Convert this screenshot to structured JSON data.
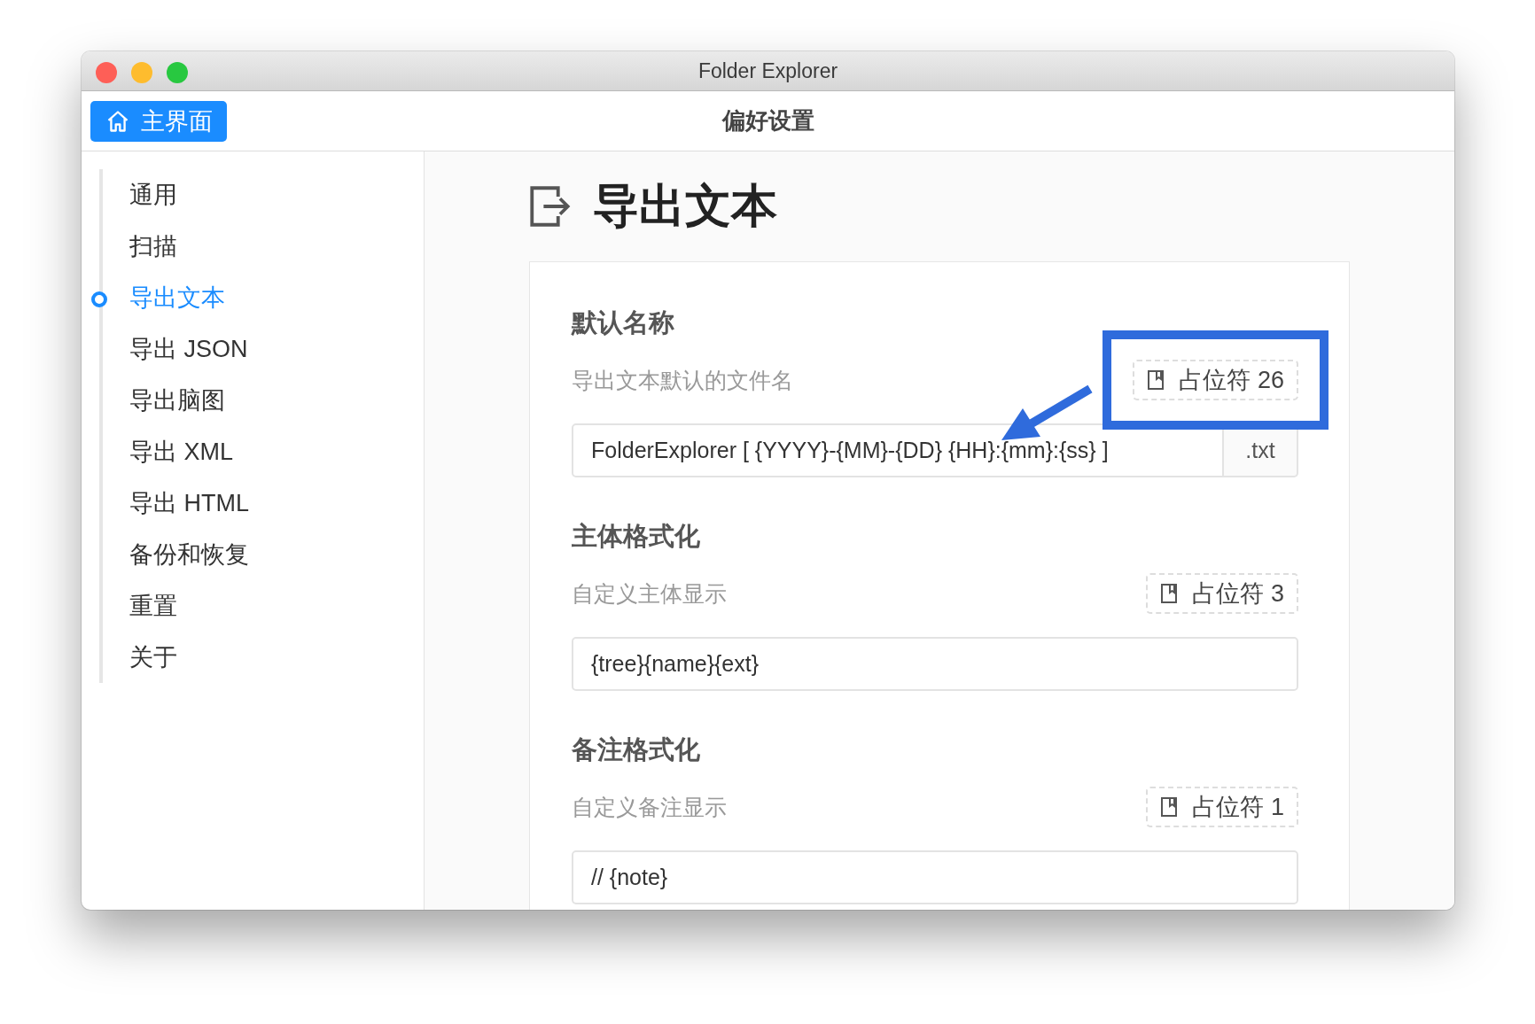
{
  "window": {
    "title": "Folder Explorer"
  },
  "toolbar": {
    "home_button": "主界面",
    "title": "偏好设置"
  },
  "sidebar": {
    "items": [
      {
        "label": "通用",
        "selected": false
      },
      {
        "label": "扫描",
        "selected": false
      },
      {
        "label": "导出文本",
        "selected": true
      },
      {
        "label": "导出 JSON",
        "selected": false
      },
      {
        "label": "导出脑图",
        "selected": false
      },
      {
        "label": "导出 XML",
        "selected": false
      },
      {
        "label": "导出 HTML",
        "selected": false
      },
      {
        "label": "备份和恢复",
        "selected": false
      },
      {
        "label": "重置",
        "selected": false
      },
      {
        "label": "关于",
        "selected": false
      }
    ]
  },
  "page": {
    "title": "导出文本"
  },
  "sections": [
    {
      "heading": "默认名称",
      "description": "导出文本默认的文件名",
      "placeholder_button": "占位符 26",
      "highlighted": true,
      "value": "FolderExplorer [ {YYYY}-{MM}-{DD} {HH}:{mm}:{ss} ]",
      "suffix": ".txt"
    },
    {
      "heading": "主体格式化",
      "description": "自定义主体显示",
      "placeholder_button": "占位符 3",
      "highlighted": false,
      "value": "{tree}{name}{ext}"
    },
    {
      "heading": "备注格式化",
      "description": "自定义备注显示",
      "placeholder_button": "占位符 1",
      "highlighted": false,
      "value": "// {note}"
    }
  ]
}
